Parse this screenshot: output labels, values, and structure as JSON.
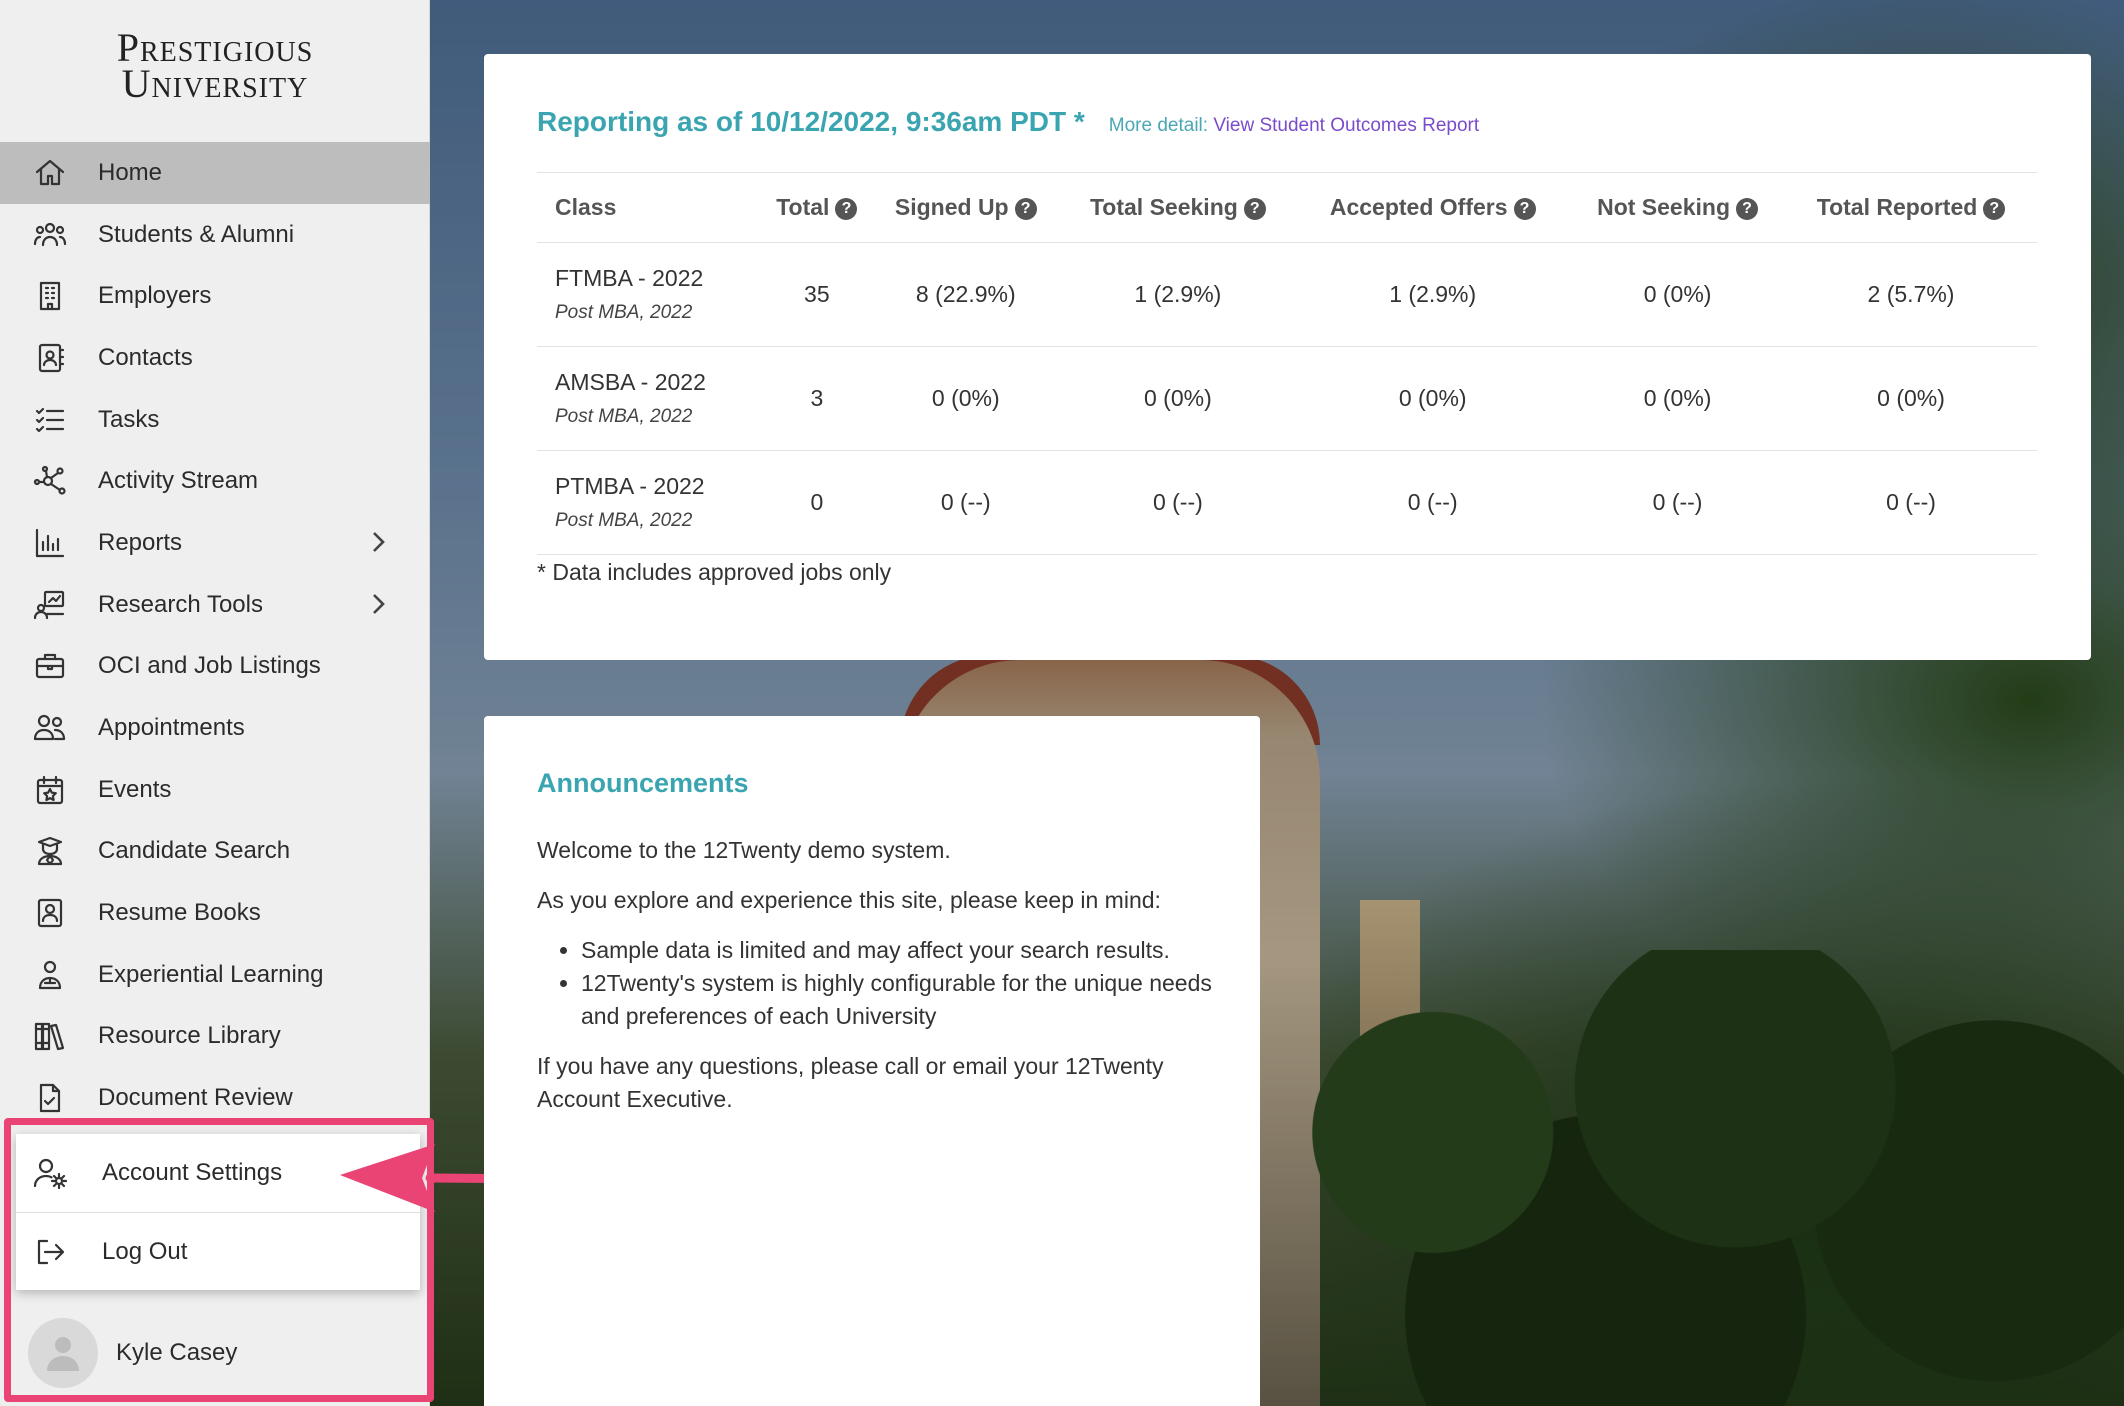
{
  "brand": {
    "logo_line1": "Prestigious",
    "logo_line2": "University"
  },
  "nav": {
    "items": [
      {
        "label": "Home",
        "icon": "home-icon",
        "active": true
      },
      {
        "label": "Students & Alumni",
        "icon": "users-icon"
      },
      {
        "label": "Employers",
        "icon": "building-icon"
      },
      {
        "label": "Contacts",
        "icon": "contact-book-icon"
      },
      {
        "label": "Tasks",
        "icon": "checklist-icon"
      },
      {
        "label": "Activity Stream",
        "icon": "network-icon"
      },
      {
        "label": "Reports",
        "icon": "bar-chart-icon",
        "has_submenu": true
      },
      {
        "label": "Research Tools",
        "icon": "research-icon",
        "has_submenu": true
      },
      {
        "label": "OCI and Job Listings",
        "icon": "briefcase-icon"
      },
      {
        "label": "Appointments",
        "icon": "people-icon"
      },
      {
        "label": "Events",
        "icon": "calendar-star-icon"
      },
      {
        "label": "Candidate Search",
        "icon": "graduate-icon"
      },
      {
        "label": "Resume Books",
        "icon": "profile-book-icon"
      },
      {
        "label": "Experiential Learning",
        "icon": "learner-icon"
      },
      {
        "label": "Resource Library",
        "icon": "library-icon"
      },
      {
        "label": "Document Review",
        "icon": "document-check-icon"
      }
    ]
  },
  "account_menu": {
    "settings_label": "Account Settings",
    "logout_label": "Log Out"
  },
  "user": {
    "name": "Kyle Casey"
  },
  "report": {
    "title": "Reporting as of 10/12/2022, 9:36am PDT *",
    "more_detail_prefix": "More detail:",
    "more_detail_link": "View Student Outcomes Report",
    "columns": [
      "Class",
      "Total",
      "Signed Up",
      "Total Seeking",
      "Accepted Offers",
      "Not Seeking",
      "Total Reported"
    ],
    "rows": [
      {
        "class": "FTMBA - 2022",
        "sub": "Post MBA, 2022",
        "cells": [
          "35",
          "8 (22.9%)",
          "1 (2.9%)",
          "1 (2.9%)",
          "0 (0%)",
          "2 (5.7%)"
        ]
      },
      {
        "class": "AMSBA - 2022",
        "sub": "Post MBA, 2022",
        "cells": [
          "3",
          "0 (0%)",
          "0 (0%)",
          "0 (0%)",
          "0 (0%)",
          "0 (0%)"
        ]
      },
      {
        "class": "PTMBA - 2022",
        "sub": "Post MBA, 2022",
        "cells": [
          "0",
          "0 (--)",
          "0 (--)",
          "0 (--)",
          "0 (--)",
          "0 (--)"
        ]
      }
    ],
    "footnote": "* Data includes approved jobs only"
  },
  "announcements": {
    "title": "Announcements",
    "intro": "Welcome to the 12Twenty demo system.",
    "lead": "As you explore and experience this site, please keep in mind:",
    "bullets": [
      "Sample data is limited and may affect your search results.",
      "12Twenty's system is highly configurable for the unique needs and preferences of each University"
    ],
    "closing": "If you have any questions, please call or email your 12Twenty Account Executive."
  },
  "colors": {
    "accent": "#3aa5b0",
    "link": "#7a4ccc",
    "highlight": "#e94474",
    "sidebar_bg": "#efefef",
    "active_bg": "#bdbdbd"
  }
}
